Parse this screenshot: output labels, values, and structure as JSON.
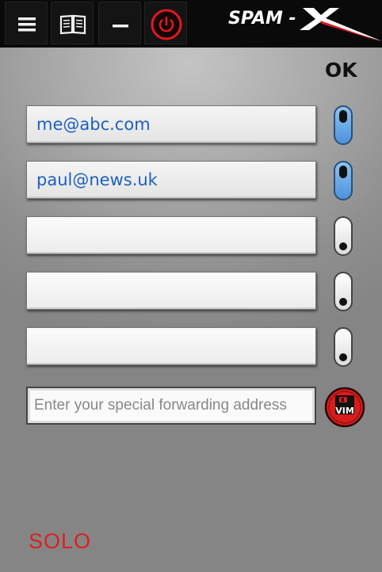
{
  "app": {
    "logo_text": "SPAM-X"
  },
  "toolbar": {
    "buttons": [
      {
        "icon": "menu-icon"
      },
      {
        "icon": "book-icon"
      },
      {
        "icon": "minimize-icon"
      },
      {
        "icon": "power-icon",
        "color": "#e0191e"
      }
    ]
  },
  "header": {
    "ok_label": "OK"
  },
  "addresses": [
    {
      "value": "me@abc.com",
      "enabled": true
    },
    {
      "value": "paul@news.uk",
      "enabled": true
    },
    {
      "value": "",
      "enabled": false
    },
    {
      "value": "",
      "enabled": false
    },
    {
      "value": "",
      "enabled": false
    }
  ],
  "forwarding": {
    "placeholder": "Enter your special forwarding address",
    "value": "",
    "button_label": "VIM",
    "button_color": "#d81c1c"
  },
  "footer": {
    "mode_label": "SOLO",
    "mode_color": "#d9221f"
  },
  "colors": {
    "accent_blue": "#4d92dc",
    "text_blue": "#1d5fc1"
  }
}
